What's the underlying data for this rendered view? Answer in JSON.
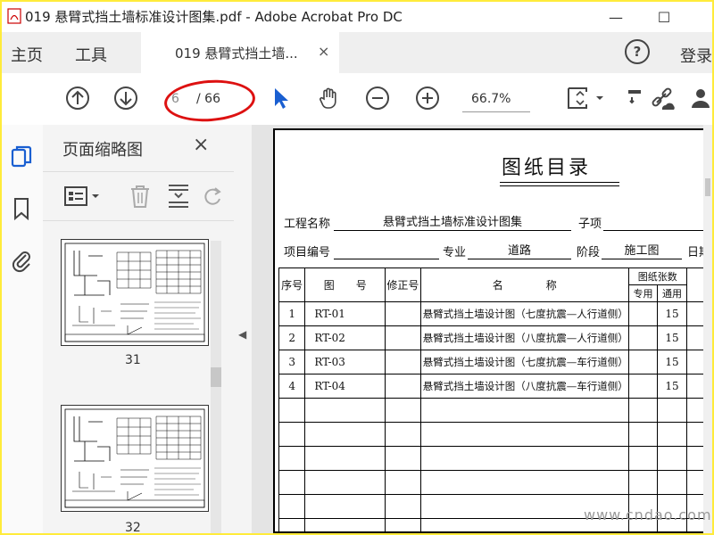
{
  "window": {
    "title": "019 悬臂式挡土墙标准设计图集.pdf - Adobe Acrobat Pro DC",
    "minimize": "—",
    "maximize": "☐"
  },
  "nav": {
    "home": "主页",
    "tools": "工具",
    "doc_tab": "019 悬臂式挡土墙...",
    "close_tab": "×",
    "help": "?",
    "login": "登录"
  },
  "toolbar": {
    "page_current": "6",
    "page_total": "/ 66",
    "zoom": "66.7%"
  },
  "sidebar": {
    "panel_title": "页面缩略图",
    "close": "×"
  },
  "thumbnails": [
    {
      "page": "31"
    },
    {
      "page": "32"
    }
  ],
  "document": {
    "title": "图纸目录",
    "project_name_label": "工程名称",
    "project_name": "悬臂式挡土墙标准设计图集",
    "sub_item_label": "子项",
    "project_no_label": "项目编号",
    "major_label": "专业",
    "major": "道路",
    "stage_label": "阶段",
    "stage": "施工图",
    "date_label": "日期",
    "headers": {
      "seq": "序号",
      "drawing_no": "图　　号",
      "rev_no": "修正号",
      "name": "名　　　　称",
      "sheets": "图纸张数",
      "special": "专用",
      "general": "通用"
    },
    "rows": [
      {
        "seq": "1",
        "code": "RT-01",
        "name": "悬臂式挡土墙设计图（七度抗震—人行道侧）",
        "general": "15"
      },
      {
        "seq": "2",
        "code": "RT-02",
        "name": "悬臂式挡土墙设计图（八度抗震—人行道侧）",
        "general": "15"
      },
      {
        "seq": "3",
        "code": "RT-03",
        "name": "悬臂式挡土墙设计图（七度抗震—车行道侧）",
        "general": "15"
      },
      {
        "seq": "4",
        "code": "RT-04",
        "name": "悬臂式挡土墙设计图（八度抗震—车行道侧）",
        "general": "15"
      }
    ]
  },
  "watermark": "www.cndao.com",
  "colors": {
    "frame": "#ffeb3b",
    "annotation": "#dd1111",
    "accent_blue": "#1a5fd1"
  }
}
